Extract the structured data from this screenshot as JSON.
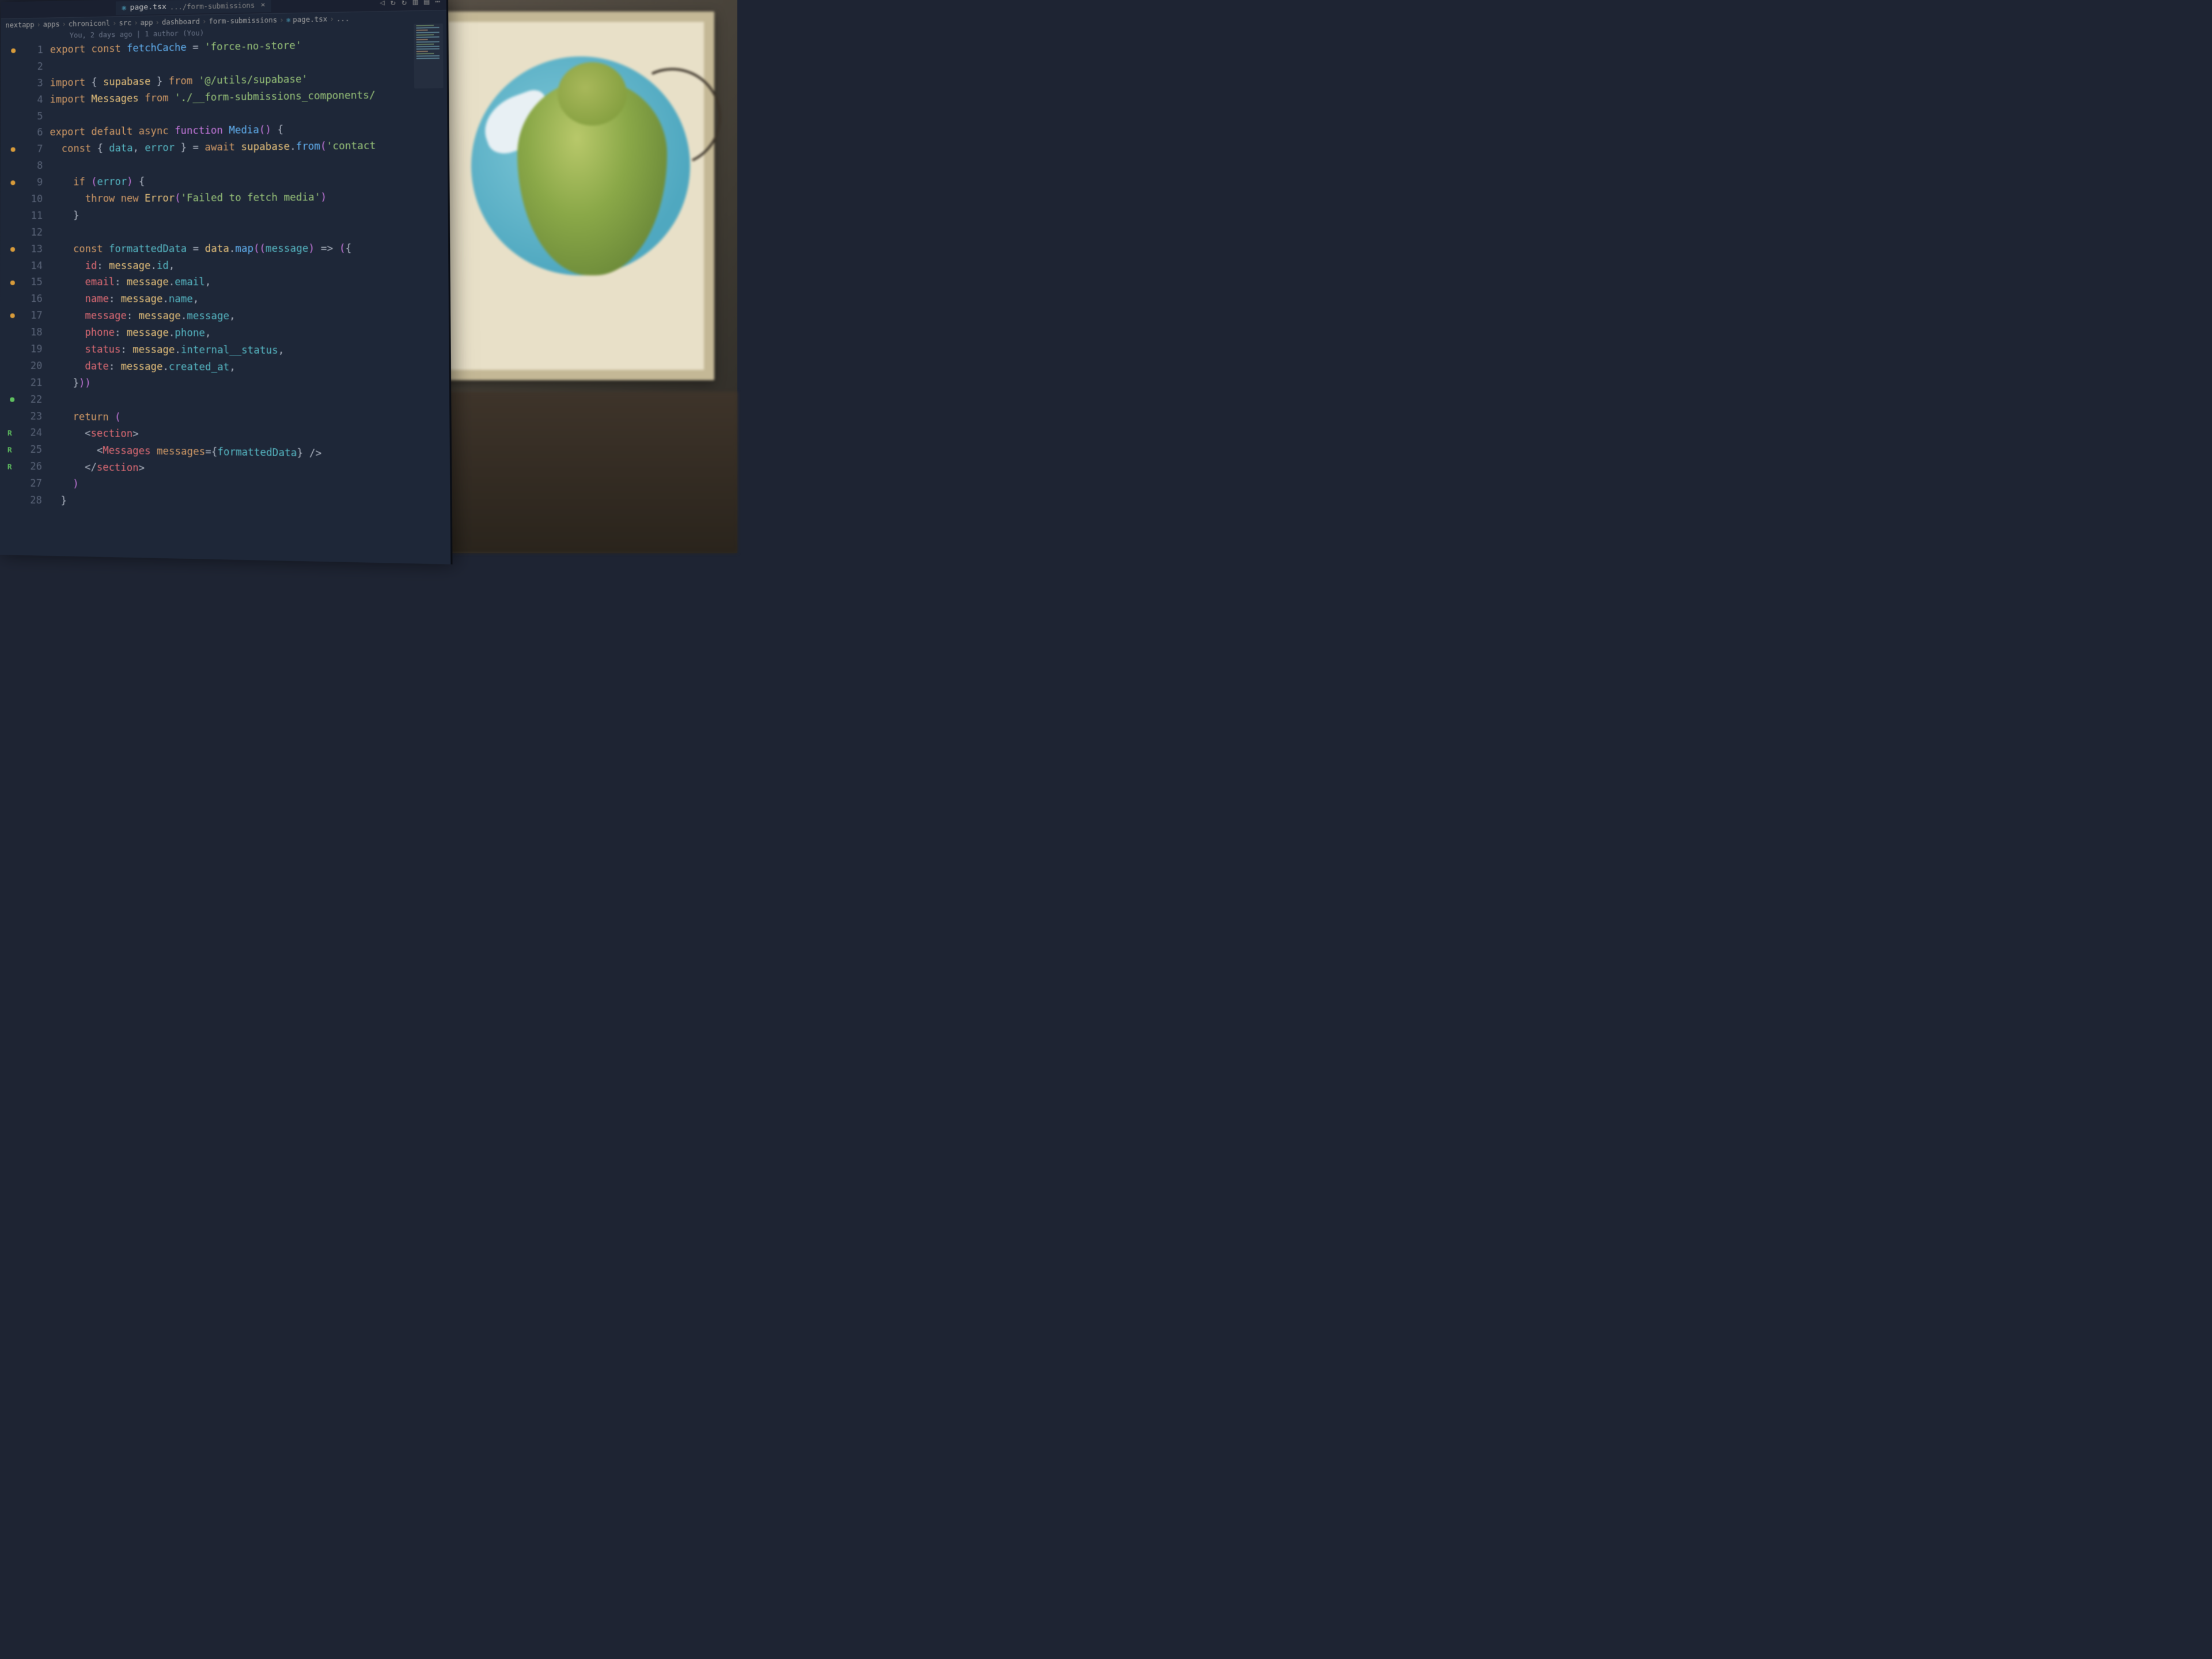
{
  "tab": {
    "icon": "react",
    "filename": "page.tsx",
    "pathHint": ".../form-submissions",
    "close": "×"
  },
  "tabActions": {
    "back": "◁",
    "reload1": "↻",
    "reload2": "↻",
    "split": "▥",
    "layout": "▤",
    "more": "⋯"
  },
  "breadcrumb": {
    "parts": [
      "nextapp",
      "apps",
      "chroniconl",
      "src",
      "app",
      "dashboard",
      "form-submissions"
    ],
    "file": "page.tsx",
    "trailing": "...",
    "sep": "›"
  },
  "blame": "You, 2 days ago | 1 author (You)",
  "gutter": {
    "orangeDots": [
      1,
      7,
      9,
      13,
      15,
      17
    ],
    "greenDot": 22,
    "letterR": [
      24,
      25,
      26
    ]
  },
  "lines": [
    {
      "n": 1,
      "tokens": [
        [
          "kw-export",
          "export"
        ],
        [
          "sp",
          " "
        ],
        [
          "kw-const",
          "const"
        ],
        [
          "sp",
          " "
        ],
        [
          "fn",
          "fetchCache"
        ],
        [
          "sp",
          " "
        ],
        [
          "op",
          "="
        ],
        [
          "sp",
          " "
        ],
        [
          "str",
          "'force-no-store'"
        ]
      ]
    },
    {
      "n": 2,
      "tokens": []
    },
    {
      "n": 3,
      "tokens": [
        [
          "kw-import",
          "import"
        ],
        [
          "sp",
          " "
        ],
        [
          "brace",
          "{"
        ],
        [
          "sp",
          " "
        ],
        [
          "ident",
          "supabase"
        ],
        [
          "sp",
          " "
        ],
        [
          "brace",
          "}"
        ],
        [
          "sp",
          " "
        ],
        [
          "kw-from",
          "from"
        ],
        [
          "sp",
          " "
        ],
        [
          "str",
          "'@/utils/supabase'"
        ]
      ]
    },
    {
      "n": 4,
      "tokens": [
        [
          "kw-import",
          "import"
        ],
        [
          "sp",
          " "
        ],
        [
          "ident",
          "Messages"
        ],
        [
          "sp",
          " "
        ],
        [
          "kw-from",
          "from"
        ],
        [
          "sp",
          " "
        ],
        [
          "str",
          "'./__form-submissions_components/"
        ]
      ]
    },
    {
      "n": 5,
      "tokens": []
    },
    {
      "n": 6,
      "tokens": [
        [
          "kw-export",
          "export"
        ],
        [
          "sp",
          " "
        ],
        [
          "kw-default",
          "default"
        ],
        [
          "sp",
          " "
        ],
        [
          "kw-async",
          "async"
        ],
        [
          "sp",
          " "
        ],
        [
          "kw-function",
          "function"
        ],
        [
          "sp",
          " "
        ],
        [
          "fn",
          "Media"
        ],
        [
          "paren",
          "()"
        ],
        [
          "sp",
          " "
        ],
        [
          "brace",
          "{"
        ]
      ]
    },
    {
      "n": 7,
      "tokens": [
        [
          "sp",
          "  "
        ],
        [
          "kw-const",
          "const"
        ],
        [
          "sp",
          " "
        ],
        [
          "brace",
          "{"
        ],
        [
          "sp",
          " "
        ],
        [
          "var",
          "data"
        ],
        [
          "punc",
          ","
        ],
        [
          "sp",
          " "
        ],
        [
          "var",
          "error"
        ],
        [
          "sp",
          " "
        ],
        [
          "brace",
          "}"
        ],
        [
          "sp",
          " "
        ],
        [
          "op",
          "="
        ],
        [
          "sp",
          " "
        ],
        [
          "kw-await",
          "await"
        ],
        [
          "sp",
          " "
        ],
        [
          "ident",
          "supabase"
        ],
        [
          "punc",
          "."
        ],
        [
          "fn",
          "from"
        ],
        [
          "paren",
          "("
        ],
        [
          "str",
          "'contact"
        ]
      ]
    },
    {
      "n": 8,
      "tokens": []
    },
    {
      "n": 9,
      "tokens": [
        [
          "sp",
          "    "
        ],
        [
          "kw-if",
          "if"
        ],
        [
          "sp",
          " "
        ],
        [
          "paren",
          "("
        ],
        [
          "var",
          "error"
        ],
        [
          "paren",
          ")"
        ],
        [
          "sp",
          " "
        ],
        [
          "brace",
          "{"
        ]
      ]
    },
    {
      "n": 10,
      "tokens": [
        [
          "sp",
          "      "
        ],
        [
          "kw-throw",
          "throw"
        ],
        [
          "sp",
          " "
        ],
        [
          "kw-new",
          "new"
        ],
        [
          "sp",
          " "
        ],
        [
          "type",
          "Error"
        ],
        [
          "paren",
          "("
        ],
        [
          "str",
          "'Failed to fetch media'"
        ],
        [
          "paren",
          ")"
        ]
      ]
    },
    {
      "n": 11,
      "tokens": [
        [
          "sp",
          "    "
        ],
        [
          "brace",
          "}"
        ]
      ]
    },
    {
      "n": 12,
      "tokens": []
    },
    {
      "n": 13,
      "tokens": [
        [
          "sp",
          "    "
        ],
        [
          "kw-const",
          "const"
        ],
        [
          "sp",
          " "
        ],
        [
          "var",
          "formattedData"
        ],
        [
          "sp",
          " "
        ],
        [
          "op",
          "="
        ],
        [
          "sp",
          " "
        ],
        [
          "ident",
          "data"
        ],
        [
          "punc",
          "."
        ],
        [
          "fn",
          "map"
        ],
        [
          "paren",
          "(("
        ],
        [
          "var",
          "message"
        ],
        [
          "paren",
          ")"
        ],
        [
          "sp",
          " "
        ],
        [
          "op",
          "=>"
        ],
        [
          "sp",
          " "
        ],
        [
          "paren",
          "("
        ],
        [
          "brace",
          "{"
        ]
      ]
    },
    {
      "n": 14,
      "tokens": [
        [
          "sp",
          "      "
        ],
        [
          "prop",
          "id"
        ],
        [
          "punc",
          ":"
        ],
        [
          "sp",
          " "
        ],
        [
          "ident",
          "message"
        ],
        [
          "punc",
          "."
        ],
        [
          "var",
          "id"
        ],
        [
          "punc",
          ","
        ]
      ]
    },
    {
      "n": 15,
      "tokens": [
        [
          "sp",
          "      "
        ],
        [
          "prop",
          "email"
        ],
        [
          "punc",
          ":"
        ],
        [
          "sp",
          " "
        ],
        [
          "ident",
          "message"
        ],
        [
          "punc",
          "."
        ],
        [
          "var",
          "email"
        ],
        [
          "punc",
          ","
        ]
      ]
    },
    {
      "n": 16,
      "tokens": [
        [
          "sp",
          "      "
        ],
        [
          "prop",
          "name"
        ],
        [
          "punc",
          ":"
        ],
        [
          "sp",
          " "
        ],
        [
          "ident",
          "message"
        ],
        [
          "punc",
          "."
        ],
        [
          "var",
          "name"
        ],
        [
          "punc",
          ","
        ]
      ]
    },
    {
      "n": 17,
      "tokens": [
        [
          "sp",
          "      "
        ],
        [
          "prop",
          "message"
        ],
        [
          "punc",
          ":"
        ],
        [
          "sp",
          " "
        ],
        [
          "ident",
          "message"
        ],
        [
          "punc",
          "."
        ],
        [
          "var",
          "message"
        ],
        [
          "punc",
          ","
        ]
      ]
    },
    {
      "n": 18,
      "tokens": [
        [
          "sp",
          "      "
        ],
        [
          "prop",
          "phone"
        ],
        [
          "punc",
          ":"
        ],
        [
          "sp",
          " "
        ],
        [
          "ident",
          "message"
        ],
        [
          "punc",
          "."
        ],
        [
          "var",
          "phone"
        ],
        [
          "punc",
          ","
        ]
      ]
    },
    {
      "n": 19,
      "tokens": [
        [
          "sp",
          "      "
        ],
        [
          "prop",
          "status"
        ],
        [
          "punc",
          ":"
        ],
        [
          "sp",
          " "
        ],
        [
          "ident",
          "message"
        ],
        [
          "punc",
          "."
        ],
        [
          "var",
          "internal__status"
        ],
        [
          "punc",
          ","
        ]
      ]
    },
    {
      "n": 20,
      "tokens": [
        [
          "sp",
          "      "
        ],
        [
          "prop",
          "date"
        ],
        [
          "punc",
          ":"
        ],
        [
          "sp",
          " "
        ],
        [
          "ident",
          "message"
        ],
        [
          "punc",
          "."
        ],
        [
          "var",
          "created_at"
        ],
        [
          "punc",
          ","
        ]
      ]
    },
    {
      "n": 21,
      "tokens": [
        [
          "sp",
          "    "
        ],
        [
          "brace",
          "}"
        ],
        [
          "paren",
          "))"
        ]
      ]
    },
    {
      "n": 22,
      "tokens": []
    },
    {
      "n": 23,
      "tokens": [
        [
          "sp",
          "    "
        ],
        [
          "kw-return",
          "return"
        ],
        [
          "sp",
          " "
        ],
        [
          "paren",
          "("
        ]
      ]
    },
    {
      "n": 24,
      "tokens": [
        [
          "sp",
          "      "
        ],
        [
          "punc",
          "<"
        ],
        [
          "tag",
          "section"
        ],
        [
          "punc",
          ">"
        ]
      ]
    },
    {
      "n": 25,
      "tokens": [
        [
          "sp",
          "        "
        ],
        [
          "punc",
          "<"
        ],
        [
          "tag",
          "Messages"
        ],
        [
          "sp",
          " "
        ],
        [
          "attr",
          "messages"
        ],
        [
          "op",
          "="
        ],
        [
          "brace",
          "{"
        ],
        [
          "var",
          "formattedData"
        ],
        [
          "brace",
          "}"
        ],
        [
          "sp",
          " "
        ],
        [
          "punc",
          "/>"
        ]
      ]
    },
    {
      "n": 26,
      "tokens": [
        [
          "sp",
          "      "
        ],
        [
          "punc",
          "</"
        ],
        [
          "tag",
          "section"
        ],
        [
          "punc",
          ">"
        ]
      ]
    },
    {
      "n": 27,
      "tokens": [
        [
          "sp",
          "    "
        ],
        [
          "paren",
          ")"
        ]
      ]
    },
    {
      "n": 28,
      "tokens": [
        [
          "sp",
          "  "
        ],
        [
          "brace",
          "}"
        ]
      ]
    }
  ]
}
